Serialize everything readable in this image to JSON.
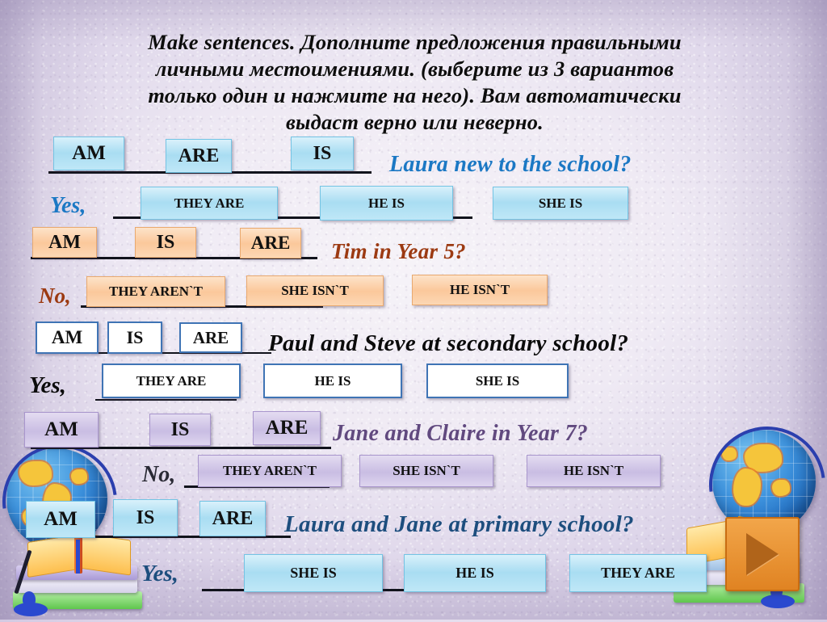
{
  "header": {
    "line1": "Make sentences. Дополните предложения правильными",
    "line2": "личными местоимениями. (выберите из 3 вариантов",
    "line3": "только один и нажмите на него). Вам автоматически",
    "line4": "выдаст верно или неверно."
  },
  "colors": {
    "blue": "#1b78c4",
    "brown": "#9c3a12",
    "black": "#0b0b0b",
    "purple": "#61497f",
    "navy": "#1d4e7e",
    "box_blue_fill": "#a9ddf2",
    "box_peach_fill": "#fbc89b",
    "box_white_fill": "#ffffff",
    "box_lavender_fill": "#c9bde3",
    "next_button": "#e08322"
  },
  "exercises": [
    {
      "id": 1,
      "verb_options": [
        "AM",
        "ARE",
        "IS"
      ],
      "question": "Laura new to the school?",
      "lead": "Yes,",
      "answer_options": [
        "THEY ARE",
        "HE IS",
        "SHE IS"
      ]
    },
    {
      "id": 2,
      "verb_options": [
        "AM",
        "IS",
        "ARE"
      ],
      "question": "Tim in Year 5?",
      "lead": "No,",
      "answer_options": [
        "THEY AREN`T",
        "SHE ISN`T",
        "HE ISN`T"
      ]
    },
    {
      "id": 3,
      "verb_options": [
        "AM",
        "IS",
        "ARE"
      ],
      "question": "Paul and Steve at secondary school?",
      "lead": "Yes,",
      "answer_options": [
        "THEY ARE",
        "HE IS",
        "SHE IS"
      ]
    },
    {
      "id": 4,
      "verb_options": [
        "AM",
        "IS",
        "ARE"
      ],
      "question": "Jane and Claire in Year 7?",
      "lead": "No,",
      "answer_options": [
        "THEY AREN`T",
        "SHE ISN`T",
        "HE ISN`T"
      ]
    },
    {
      "id": 5,
      "verb_options": [
        "AM",
        "IS",
        "ARE"
      ],
      "question": "Laura and Jane at primary school?",
      "lead": "Yes,",
      "answer_options": [
        "SHE IS",
        "HE IS",
        "THEY ARE"
      ]
    }
  ],
  "decorations": {
    "globe_left": "globe-icon",
    "globe_right": "globe-icon",
    "books_left": "book-stack-icon",
    "books_right": "book-stack-icon",
    "pen_left": "pen-icon",
    "pen_right": "pen-icon",
    "next_button": "play-triangle-icon"
  }
}
